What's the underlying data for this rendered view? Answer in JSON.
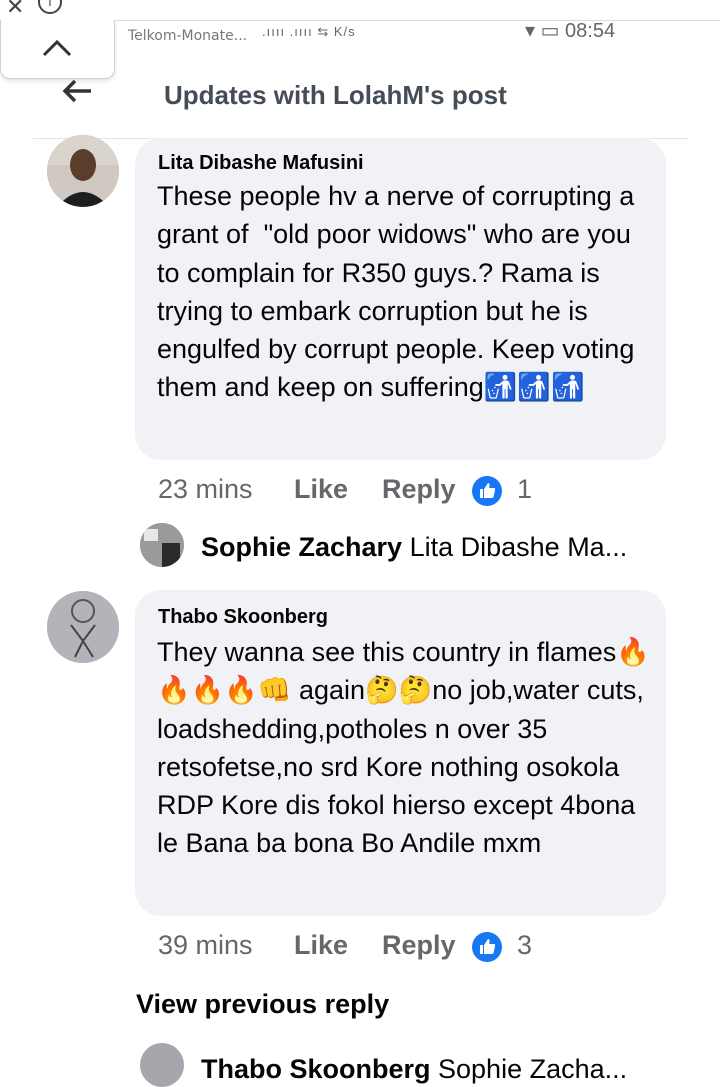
{
  "status_bar": {
    "carrier": "Telkom-Monate...",
    "signal": ".ıııı  .ıııı  ⇆ K/s",
    "battery_time": "▾ ▭ 08:54"
  },
  "header": {
    "title": "Updates with LolahM's post"
  },
  "comments": [
    {
      "author": "Lita Dibashe Mafusini",
      "text": "These people hv a nerve of corrupting a grant of  \"old poor widows\" who are you to complain for R350 guys.? Rama is trying to embark corruption but he is engulfed by corrupt people. Keep voting them and keep on suffering🚮🚮🚮",
      "time": "23 mins",
      "like_label": "Like",
      "reply_label": "Reply",
      "reaction_count": "1",
      "reply_preview": {
        "name": "Sophie Zachary",
        "text": "Lita Dibashe Ma..."
      }
    },
    {
      "author": "Thabo Skoonberg",
      "text": "They wanna see this country in flames🔥🔥🔥🔥👊 again🤔🤔no job,water cuts, loadshedding,potholes n over 35 retsofetse,no srd Kore nothing osokola RDP Kore dis fokol hierso except 4bona le Bana ba bona Bo Andile mxm",
      "time": "39 mins",
      "like_label": "Like",
      "reply_label": "Reply",
      "reaction_count": "3"
    }
  ],
  "view_previous": "View previous reply",
  "bottom_reply_preview": {
    "name": "Thabo Skoonberg",
    "text": "Sophie Zacha..."
  },
  "colors": {
    "accent": "#1877f2",
    "bubble": "#f0f2f5",
    "muted": "#65676b",
    "title": "#444c55"
  },
  "icons": [
    "close-icon",
    "info-icon",
    "chevron-up-icon",
    "back-arrow-icon",
    "like-icon"
  ]
}
